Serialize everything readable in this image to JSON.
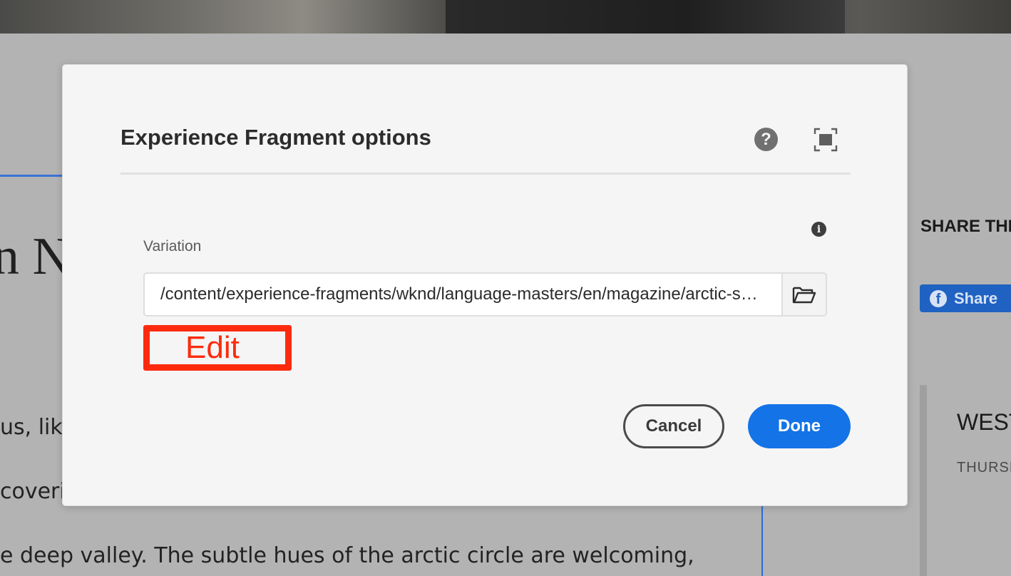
{
  "background_page": {
    "heading_fragment": "n N",
    "text_lines": [
      "us, like",
      "coverin",
      "e  deep  valley.  The  subtle  hues  of  the  arctic  circle  are  welcoming,"
    ],
    "share_title": "SHARE THI",
    "share_button": "Share",
    "side_card_title": "WEST",
    "side_card_date": "THURSD",
    "facebook_icon": "facebook-icon"
  },
  "dialog": {
    "title": "Experience Fragment options",
    "help_icon": "help-icon",
    "fullscreen_icon": "fullscreen-icon",
    "info_icon": "info-icon",
    "variation_label": "Variation",
    "variation_value": "/content/experience-fragments/wknd/language-masters/en/magazine/arctic-surfing",
    "browse_icon": "folder-icon",
    "edit_label": "Edit",
    "cancel_label": "Cancel",
    "done_label": "Done"
  },
  "colors": {
    "primary": "#1473e6",
    "annotation": "#fc2b0e",
    "facebook": "#1f62c2"
  }
}
